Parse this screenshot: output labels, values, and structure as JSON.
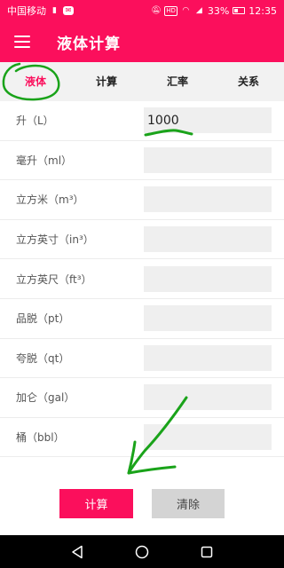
{
  "status_bar": {
    "carrier": "中国移动",
    "chat_icon": "chat-icon",
    "network_badge": "HD",
    "battery_percent": "33%",
    "time": "12:35"
  },
  "app_bar": {
    "menu_icon": "hamburger-icon",
    "title": "液体计算"
  },
  "tabs": [
    {
      "label": "液体",
      "active": true
    },
    {
      "label": "计算",
      "active": false
    },
    {
      "label": "汇率",
      "active": false
    },
    {
      "label": "关系",
      "active": false
    }
  ],
  "fields": [
    {
      "label": "升（L）",
      "value": "1000"
    },
    {
      "label": "毫升（ml）",
      "value": ""
    },
    {
      "label": "立方米（m³）",
      "value": ""
    },
    {
      "label": "立方英寸（in³）",
      "value": ""
    },
    {
      "label": "立方英尺（ft³）",
      "value": ""
    },
    {
      "label": "品脱（pt）",
      "value": ""
    },
    {
      "label": "夸脱（qt）",
      "value": ""
    },
    {
      "label": "加仑（gal）",
      "value": ""
    },
    {
      "label": "桶（bbl）",
      "value": ""
    }
  ],
  "buttons": {
    "calculate": "计算",
    "clear": "清除"
  },
  "nav": {
    "back_icon": "back-triangle-icon",
    "home_icon": "home-circle-icon",
    "recents_icon": "recents-square-icon"
  },
  "colors": {
    "primary": "#fb0f5c",
    "tab_bar_bg": "#f2f2f2",
    "input_bg": "#efefef",
    "clear_button_bg": "#d4d4d4",
    "annotation_green": "#1aa31a"
  }
}
